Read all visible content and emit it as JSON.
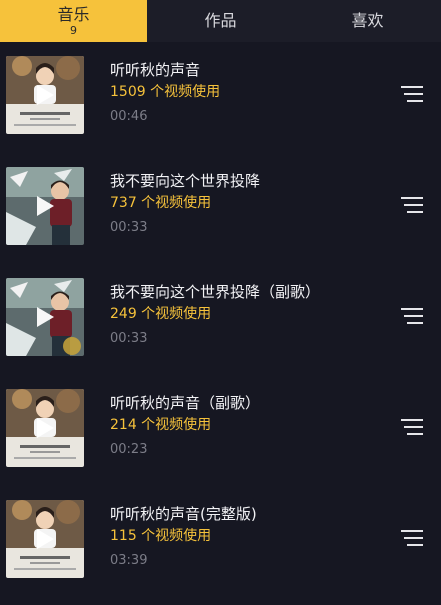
{
  "tabs": [
    {
      "label": "音乐",
      "count": "9",
      "active": true
    },
    {
      "label": "作品",
      "active": false
    },
    {
      "label": "喜欢",
      "active": false
    }
  ],
  "songs": [
    {
      "title": "听听秋的声音",
      "usage": "1509 个视频使用",
      "duration": "00:46",
      "cover": "girl"
    },
    {
      "title": "我不要向这个世界投降",
      "usage": "737 个视频使用",
      "duration": "00:33",
      "cover": "boy"
    },
    {
      "title": "我不要向这个世界投降（副歌）",
      "usage": "249 个视频使用",
      "duration": "00:33",
      "cover": "boy"
    },
    {
      "title": "听听秋的声音（副歌）",
      "usage": "214 个视频使用",
      "duration": "00:23",
      "cover": "girl"
    },
    {
      "title": "听听秋的声音(完整版)",
      "usage": "115 个视频使用",
      "duration": "03:39",
      "cover": "girl"
    }
  ],
  "colors": {
    "accent": "#f6c23b",
    "background": "#161722"
  }
}
